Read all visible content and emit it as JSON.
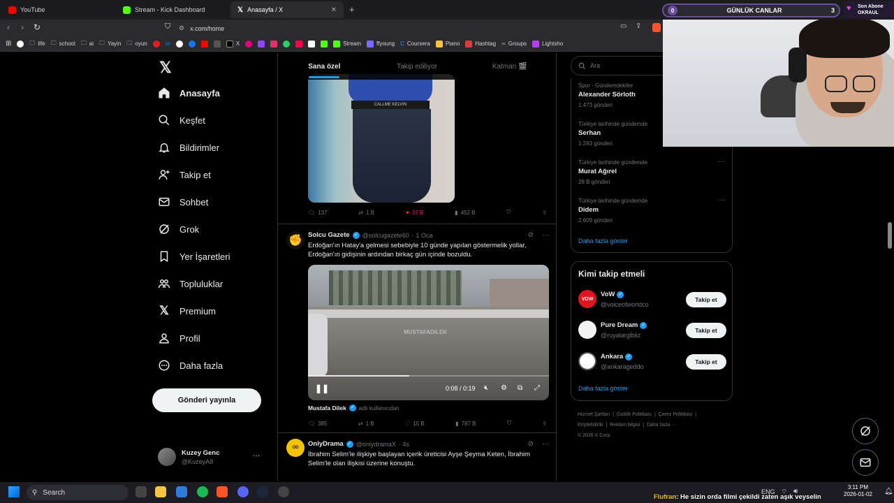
{
  "browser": {
    "tabs": [
      {
        "title": "YouTube",
        "color": "#ff0000"
      },
      {
        "title": "Stream - Kick Dashboard",
        "color": "#53fc18"
      },
      {
        "title": "Anasayfa / X",
        "color": "#ffffff"
      }
    ],
    "new_tab": "+",
    "url": "x.com/home",
    "bookmarks": [
      "life",
      "school",
      "ai",
      "Yayin",
      "oyun",
      "in",
      "X",
      "Stream",
      "ffyoung",
      "Coursera",
      "Piano",
      "Hashtag",
      "Groups",
      "Lightsho"
    ]
  },
  "overlay": {
    "bar_left": "0",
    "bar_title": "GÜNLÜK CANLAR",
    "bar_right": "3",
    "sub_label": "Son Abone",
    "sub_name": "OKRAUL"
  },
  "nav": {
    "items": [
      {
        "label": "Anasayfa",
        "icon": "home-icon"
      },
      {
        "label": "Keşfet",
        "icon": "search-icon"
      },
      {
        "label": "Bildirimler",
        "icon": "bell-icon"
      },
      {
        "label": "Takip et",
        "icon": "person-plus-icon"
      },
      {
        "label": "Sohbet",
        "icon": "mail-icon"
      },
      {
        "label": "Grok",
        "icon": "grok-icon"
      },
      {
        "label": "Yer İşaretleri",
        "icon": "bookmark-icon"
      },
      {
        "label": "Topluluklar",
        "icon": "communities-icon"
      },
      {
        "label": "Premium",
        "icon": "x-logo-icon"
      },
      {
        "label": "Profil",
        "icon": "profile-icon"
      },
      {
        "label": "Daha fazla",
        "icon": "more-circle-icon"
      }
    ],
    "post_button": "Gönderi yayınla",
    "user_name": "Kuzey Genc",
    "user_handle": "@KuzeyA8",
    "user_more": "···"
  },
  "timeline": {
    "tabs": [
      "Sana özel",
      "Takip ediliyor",
      "Katman 🎬"
    ],
    "post1": {
      "replies": "137",
      "reposts": "1 B",
      "likes": "37 B",
      "views": "452 B",
      "image_text": "CALLME KELVIN"
    },
    "post2": {
      "name": "Solcu Gazete",
      "handle": "@solcugazete60",
      "time": "· 1 Oca",
      "text": "Erdoğan'ın Hatay'a gelmesi sebebiyle 10 günde yapılan göstermelik yollar, Erdoğan'ın gidişinin ardından birkaç gün içinde bozuldu.",
      "video_time": "0:08 / 0:19",
      "video_progress": 0.42,
      "watermark": "MUSTAFADILEK",
      "credit_name": "Mustafa Dilek",
      "credit_suffix": "adlı kullanıcıdan",
      "replies": "385",
      "reposts": "1 B",
      "likes": "15 B",
      "views": "787 B"
    },
    "post3": {
      "name": "OnlyDrama",
      "handle": "@onlydramaX",
      "time": "· 4s",
      "text": "İbrahim Selim'le ilişkiye başlayan içerik üreticisi Ayşe Şeyma Keten, İbrahim Selim'le olan ilişkisi üzerine konuştu."
    }
  },
  "right": {
    "search_placeholder": "Ara",
    "trends": [
      {
        "category": "Spor · Gündemdekiler",
        "name": "Alexander Sörloth",
        "count": "1.473 gönderi"
      },
      {
        "category": "Türkiye tarihinde gündemde",
        "name": "Serhan",
        "count": "1.293 gönderi"
      },
      {
        "category": "Türkiye tarihinde gündemde",
        "name": "Murat Ağırel",
        "count": "28 B gönderi"
      },
      {
        "category": "Türkiye tarihinde gündemde",
        "name": "Didem",
        "count": "2.609 gönderi"
      }
    ],
    "trends_more": "Daha fazla göster",
    "who_title": "Kimi takip etmeli",
    "who": [
      {
        "name": "VoW",
        "handle": "@voiceofworldco",
        "button": "Takip et"
      },
      {
        "name": "Pure Dream",
        "handle": "@ruyalargibiiz",
        "button": "Takip et"
      },
      {
        "name": "Ankara",
        "handle": "@ankarageddo",
        "button": "Takip et"
      }
    ],
    "who_more": "Daha fazla göster",
    "footer": {
      "links": [
        "Hizmet Şartları",
        "Gizlilik Politikası",
        "Çerez Politikası",
        "Erişilebilirlik",
        "Reklam bilgisi",
        "Daha fazla ···"
      ],
      "copyright": "© 2026 X Corp."
    }
  },
  "taskbar": {
    "search": "Search",
    "chat_user": "Flufran",
    "chat_text": ": He sizin orda filmi çekildi zaten aşık veyselin",
    "lang": "ENG",
    "time": "3:11 PM",
    "date": "2026-01-02"
  }
}
